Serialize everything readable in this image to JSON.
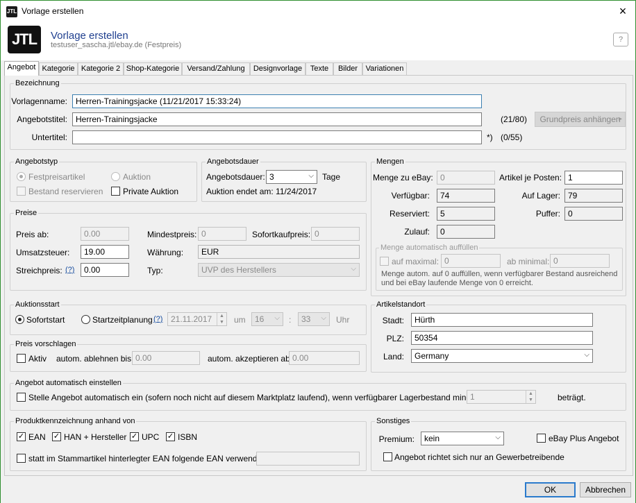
{
  "window": {
    "title": "Vorlage erstellen",
    "close": "×",
    "app_logo": "JTL"
  },
  "header": {
    "title": "Vorlage erstellen",
    "subtitle": "testuser_sascha.jtl/ebay.de (Festpreis)",
    "logo": "JTL",
    "help": "?"
  },
  "tabs": [
    {
      "label": "Angebot"
    },
    {
      "label": "Kategorie"
    },
    {
      "label": "Kategorie 2"
    },
    {
      "label": "Shop-Kategorie"
    },
    {
      "label": "Versand/Zahlung"
    },
    {
      "label": "Designvorlage"
    },
    {
      "label": "Texte"
    },
    {
      "label": "Bilder"
    },
    {
      "label": "Variationen"
    }
  ],
  "bezeichnung": {
    "group": "Bezeichnung",
    "vorlagenname_label": "Vorlagenname:",
    "vorlagenname_value": "Herren-Trainingsjacke  (11/21/2017 15:33:24)",
    "angebotstitel_label": "Angebotstitel:",
    "angebotstitel_value": "Herren-Trainingsjacke",
    "angebotstitel_count": "(21/80)",
    "grundpreis_button": "Grundpreis anhängen",
    "untertitel_label": "Untertitel:",
    "untertitel_value": "",
    "untertitel_star": "*)",
    "untertitel_count": "(0/55)"
  },
  "angebotstyp": {
    "group": "Angebotstyp",
    "festpreis": "Festpreisartikel",
    "auktion": "Auktion",
    "bestand": "Bestand reservieren",
    "private": "Private Auktion"
  },
  "angebotsdauer": {
    "group": "Angebotsdauer",
    "label": "Angebotsdauer:",
    "value": "3",
    "unit": "Tage",
    "ende": "Auktion endet am: 11/24/2017"
  },
  "mengen": {
    "group": "Mengen",
    "menge_ebay_label": "Menge zu eBay:",
    "menge_ebay": "0",
    "artikel_posten_label": "Artikel je Posten:",
    "artikel_posten": "1",
    "verfuegbar_label": "Verfügbar:",
    "verfuegbar": "74",
    "auf_lager_label": "Auf Lager:",
    "auf_lager": "79",
    "reserviert_label": "Reserviert:",
    "reserviert": "5",
    "puffer_label": "Puffer:",
    "puffer": "0",
    "zulauf_label": "Zulauf:",
    "zulauf": "0",
    "auto_group": "Menge automatisch auffüllen",
    "auf_maximal": "auf maximal:",
    "auf_maximal_value": "0",
    "ab_minimal": "ab minimal:",
    "ab_minimal_value": "0",
    "note1": "Menge autom. auf 0 auffüllen, wenn verfügbarer Bestand ausreichend",
    "note2": "und bei eBay laufende Menge von 0 erreicht."
  },
  "preise": {
    "group": "Preise",
    "preis_ab_label": "Preis ab:",
    "preis_ab": "0.00",
    "mindestpreis_label": "Mindestpreis:",
    "mindestpreis": "0",
    "sofortkauf_label": "Sofortkaufpreis:",
    "sofortkauf": "0",
    "ust_label": "Umsatzsteuer:",
    "ust": "19.00",
    "waehrung_label": "Währung:",
    "waehrung": "EUR",
    "streich_label": "Streichpreis:",
    "streich_help": "(?)",
    "streich": "0.00",
    "typ_label": "Typ:",
    "typ": "UVP des Herstellers"
  },
  "auktionsstart": {
    "group": "Auktionsstart",
    "sofort": "Sofortstart",
    "planung": "Startzeitplanung",
    "help": "(?)",
    "datum": "21.11.2017",
    "um": "um",
    "stunde": "16",
    "colon": ":",
    "minute": "33",
    "uhr": "Uhr"
  },
  "vorschlagen": {
    "group": "Preis vorschlagen",
    "aktiv": "Aktiv",
    "ablehnen_label": "autom. ablehnen bis:",
    "ablehnen": "0.00",
    "akzeptieren_label": "autom. akzeptieren ab:",
    "akzeptieren": "0.00"
  },
  "standort": {
    "group": "Artikelstandort",
    "stadt_label": "Stadt:",
    "stadt": "Hürth",
    "plz_label": "PLZ:",
    "plz": "50354",
    "land_label": "Land:",
    "land": "Germany"
  },
  "auto_einstellen": {
    "group": "Angebot automatisch einstellen",
    "text": "Stelle Angebot automatisch ein (sofern noch nicht auf diesem Marktplatz laufend), wenn verfügbarer Lagerbestand mindestens",
    "value": "1",
    "suffix": "beträgt."
  },
  "produkt": {
    "group": "Produktkennzeichnung anhand von",
    "ean": "EAN",
    "han": "HAN + Hersteller",
    "upc": "UPC",
    "isbn": "ISBN",
    "statt": "statt im Stammartikel hinterlegter EAN folgende EAN verwenden:",
    "statt_value": ""
  },
  "sonstiges": {
    "group": "Sonstiges",
    "premium_label": "Premium:",
    "premium": "kein",
    "ebay_plus": "eBay Plus Angebot",
    "gewerbe": "Angebot richtet sich nur an Gewerbetreibende"
  },
  "footer": {
    "ok": "OK",
    "abbrechen": "Abbrechen"
  },
  "icons": {
    "check": "✓",
    "chevron": "⌵",
    "arrow": "▸"
  }
}
